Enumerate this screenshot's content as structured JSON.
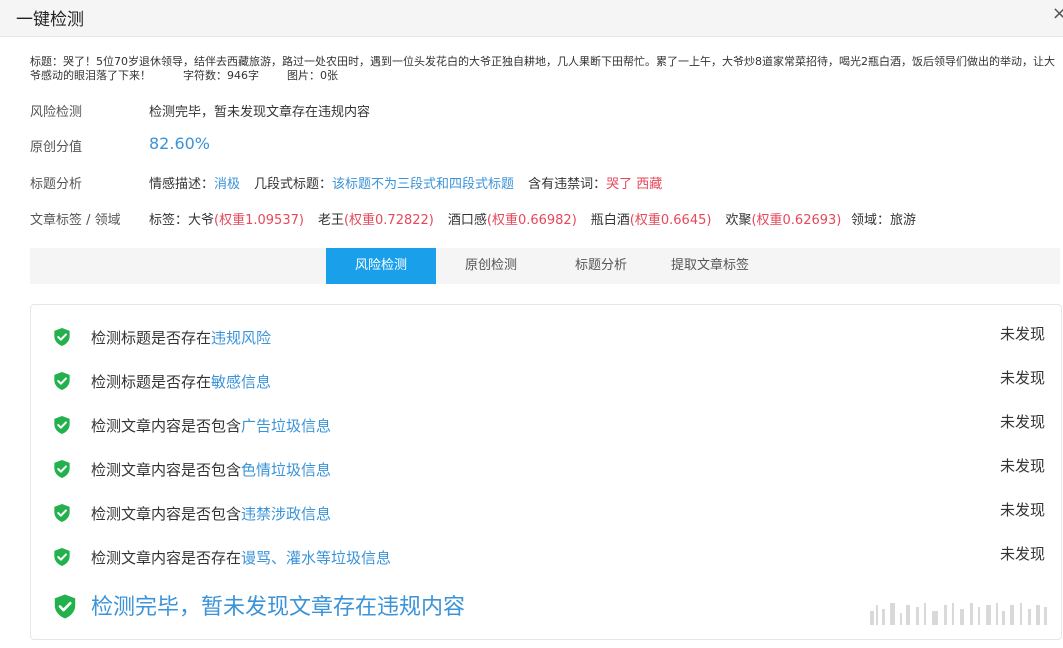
{
  "header": {
    "title": "一键检测",
    "close_label": "×"
  },
  "article": {
    "title_line": "标题：哭了！5位70岁退休领导，结伴去西藏旅游，路过一处农田时，遇到一位头发花白的大爷正独自耕地，几人果断下田帮忙。累了一上午，大爷炒8道家常菜招待，喝光2瓶白酒，饭后领导们做出的举动，让大爷感动的眼泪落了下来！",
    "char_count": "字符数：946字",
    "image_count": "图片：0张"
  },
  "info": {
    "risk": {
      "label": "风险检测",
      "value": "检测完毕，暂未发现文章存在违规内容"
    },
    "originality": {
      "label": "原创分值",
      "value": "82.60%"
    },
    "title_analysis": {
      "label": "标题分析",
      "sentiment_label": "情感描述：",
      "sentiment_value": "消极",
      "segment_label": "几段式标题：",
      "segment_value": "该标题不为三段式和四段式标题",
      "banned_label": "含有违禁词：",
      "banned_value": "哭了 西藏"
    },
    "tags": {
      "label": "文章标签 / 领域",
      "prefix": "标签：",
      "items": [
        {
          "name": "大爷",
          "weight": "(权重1.09537)"
        },
        {
          "name": "老王",
          "weight": "(权重0.72822)"
        },
        {
          "name": "酒口感",
          "weight": "(权重0.66982)"
        },
        {
          "name": "瓶白酒",
          "weight": "(权重0.6645)"
        },
        {
          "name": "欢聚",
          "weight": "(权重0.62693)"
        }
      ],
      "domain": "领域：旅游"
    }
  },
  "tabs": [
    "风险检测",
    "原创检测",
    "标题分析",
    "提取文章标签"
  ],
  "active_tab": 0,
  "checks": [
    {
      "prefix": "检测标题是否存在",
      "keyword": "违规风险",
      "status": "未发现"
    },
    {
      "prefix": "检测标题是否存在",
      "keyword": "敏感信息",
      "status": "未发现"
    },
    {
      "prefix": "检测文章内容是否包含",
      "keyword": "广告垃圾信息",
      "status": "未发现"
    },
    {
      "prefix": "检测文章内容是否包含",
      "keyword": "色情垃圾信息",
      "status": "未发现"
    },
    {
      "prefix": "检测文章内容是否包含",
      "keyword": "违禁涉政信息",
      "status": "未发现"
    },
    {
      "prefix": "检测文章内容是否存在",
      "keyword": "谩骂、灌水等垃圾信息",
      "status": "未发现"
    }
  ],
  "final_message": "检测完毕，暂未发现文章存在违规内容",
  "colors": {
    "accent": "#3b93d8",
    "tab_active": "#1aa0eb",
    "shield": "#22b14c",
    "warning": "#e6485b"
  },
  "icons": {
    "check": "shield-check-icon",
    "close": "close-icon"
  }
}
